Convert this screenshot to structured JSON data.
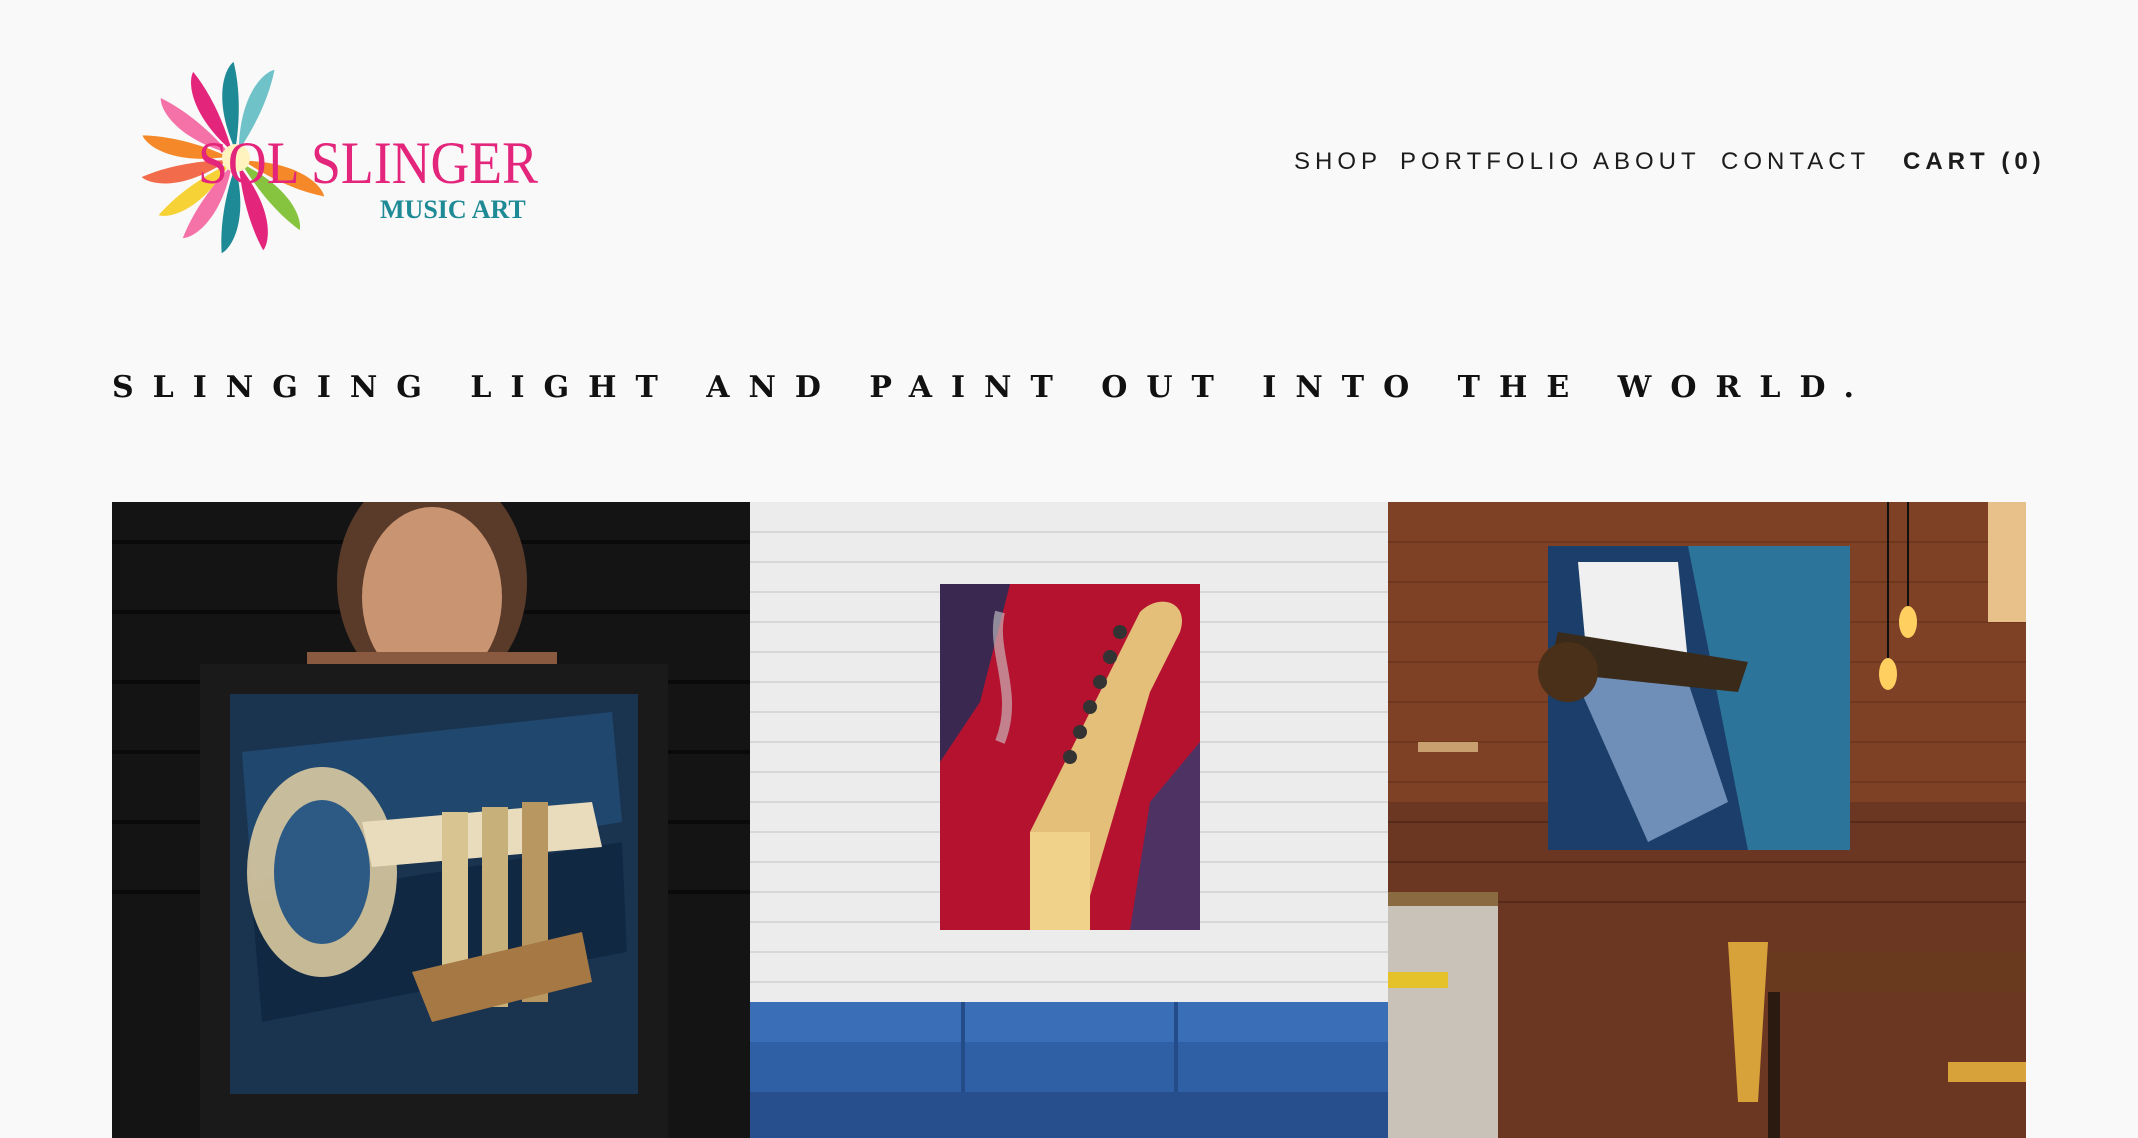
{
  "brand": {
    "name_line1": "SOL SLINGER",
    "name_line2": "MUSIC ART",
    "colors": {
      "pink": "#e4257c",
      "teal": "#1e8a96",
      "orange": "#f5892a",
      "yellow": "#f7d236"
    }
  },
  "nav": {
    "items": [
      "SHOP",
      "PORTFOLIO",
      "ABOUT",
      "CONTACT"
    ],
    "cart_label": "CART (0)"
  },
  "hero": {
    "tagline": "SLINGING LIGHT AND PAINT OUT INTO THE WORLD."
  },
  "gallery": {
    "images": [
      "artist-holding-trumpet-painting",
      "guitar-headstock-painting-above-sofa",
      "guitarist-painting-in-brick-cafe"
    ]
  }
}
